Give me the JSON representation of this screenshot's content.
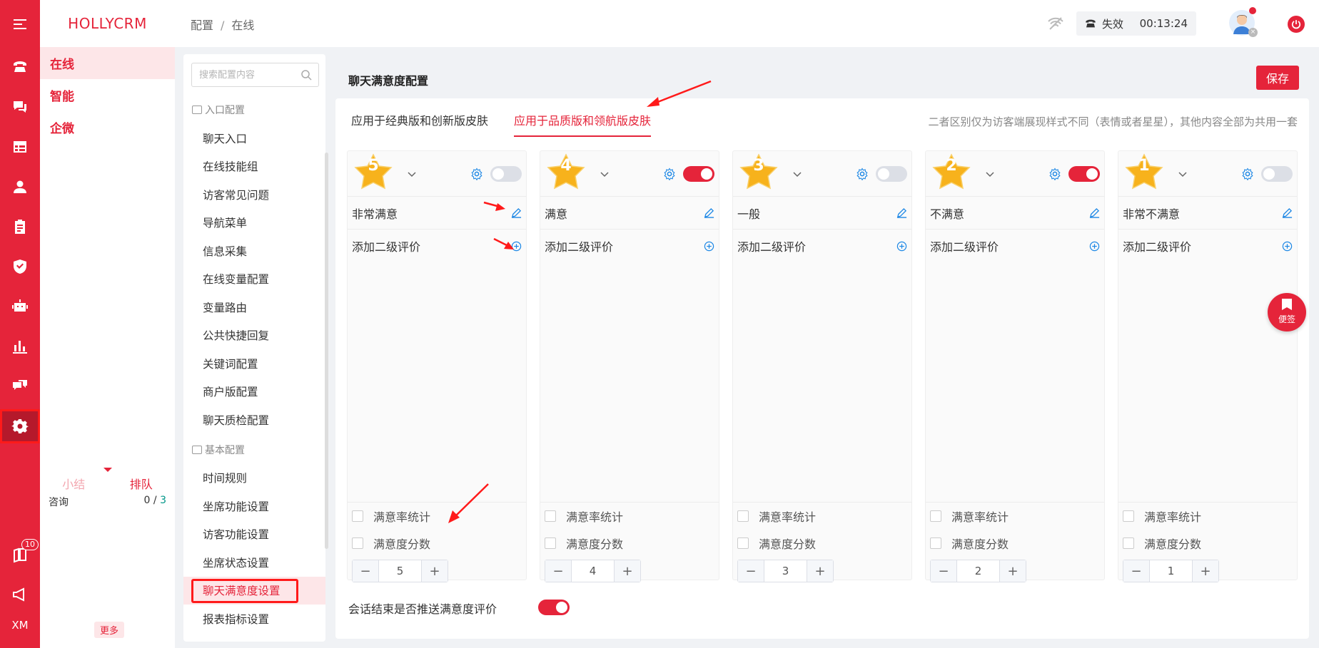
{
  "app": {
    "brand": "HOLLYCRM"
  },
  "iconbar": {
    "items": [
      "phone-icon",
      "chat-icon",
      "grid-icon",
      "user-icon",
      "clipboard-icon",
      "shield-icon",
      "robot-icon",
      "bar-chart-icon",
      "messages-icon",
      "gear-icon",
      "book-icon",
      "megaphone-icon"
    ],
    "active": "gear-icon",
    "book_badge": "10",
    "bottom_label": "XM"
  },
  "subnav": {
    "items": [
      "在线",
      "智能",
      "企微"
    ],
    "bottom_tabs": [
      "小结",
      "排队"
    ],
    "consult_label": "咨询",
    "consult_count": "0",
    "consult_sep": " / ",
    "consult_total": "3",
    "more": "更多"
  },
  "topbar": {
    "breadcrumb": [
      "配置",
      "在线"
    ],
    "status": "失效",
    "timer": "00:13:24"
  },
  "config_list": {
    "search_placeholder": "搜索配置内容",
    "group1": "入口配置",
    "group1_items": [
      "聊天入口",
      "在线技能组",
      "访客常见问题",
      "导航菜单",
      "信息采集",
      "在线变量配置",
      "变量路由",
      "公共快捷回复",
      "关键词配置",
      "商户版配置",
      "聊天质检配置"
    ],
    "group2": "基本配置",
    "group2_items": [
      "时间规则",
      "坐席功能设置",
      "访客功能设置",
      "坐席状态设置",
      "聊天满意度设置",
      "报表指标设置"
    ],
    "active_item": "聊天满意度设置"
  },
  "main": {
    "title": "聊天满意度配置",
    "save": "保存",
    "tabs": [
      "应用于经典版和创新版皮肤",
      "应用于品质版和领航版皮肤"
    ],
    "active_tab": 1,
    "note": "二者区别仅为访客端展现样式不同（表情或者星星），其他内容全部为共用一套",
    "add_secondary": "添加二级评价",
    "check_rate": "满意率统计",
    "check_score": "满意度分数",
    "cards": [
      {
        "star": "5",
        "label": "非常满意",
        "enabled": false,
        "score": "5"
      },
      {
        "star": "4",
        "label": "满意",
        "enabled": true,
        "score": "4"
      },
      {
        "star": "3",
        "label": "一般",
        "enabled": false,
        "score": "3"
      },
      {
        "star": "2",
        "label": "不满意",
        "enabled": true,
        "score": "2"
      },
      {
        "star": "1",
        "label": "非常不满意",
        "enabled": false,
        "score": "1"
      }
    ],
    "push_label": "会话结束是否推送满意度评价",
    "push_enabled": true
  },
  "float_button": "便签",
  "colors": {
    "accent": "#e5243a",
    "star": "#f7b21c",
    "link_blue": "#1e88e5"
  }
}
